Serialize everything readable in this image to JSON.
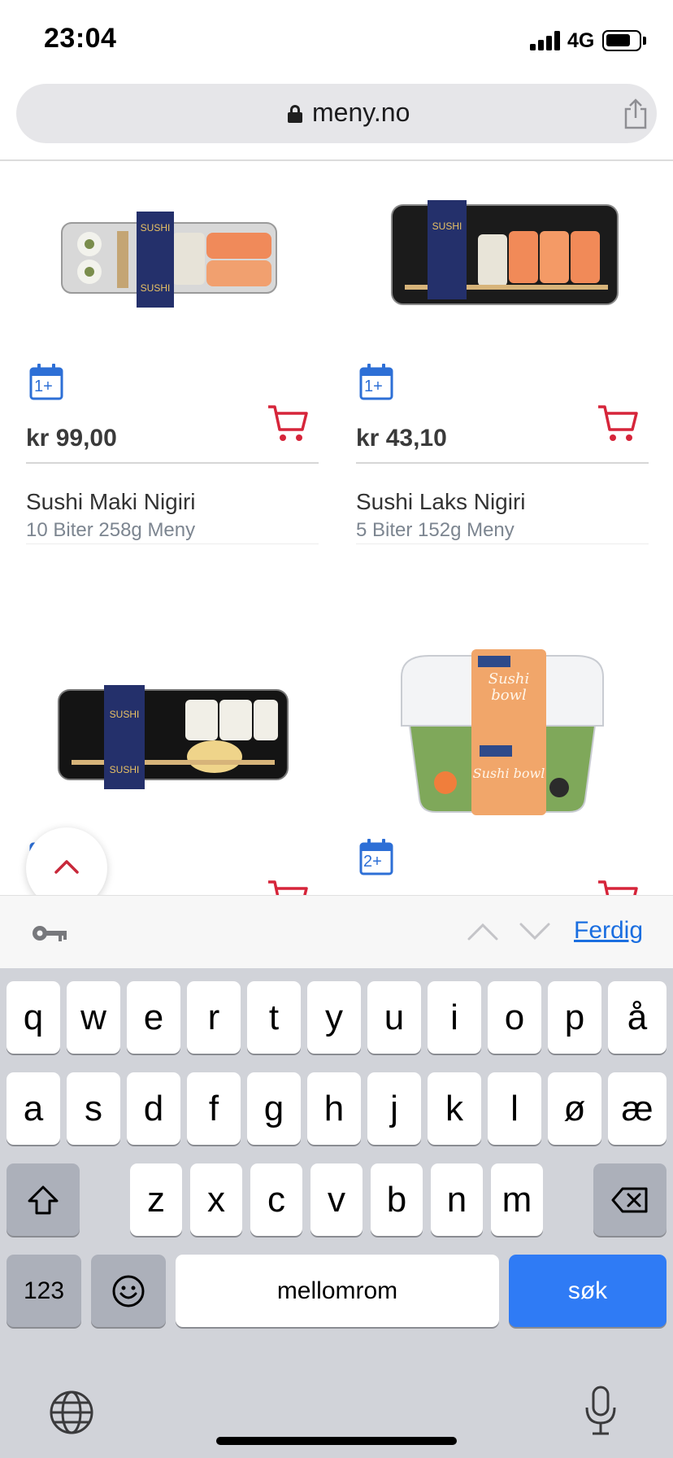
{
  "status_bar": {
    "time": "23:04",
    "network": "4G"
  },
  "browser": {
    "url": "meny.no"
  },
  "products": [
    {
      "name": "Sushi Maki Nigiri",
      "sub": "10 Biter 258g Meny",
      "price": "kr 99,00",
      "badge": "1+"
    },
    {
      "name": "Sushi Laks Nigiri",
      "sub": "5 Biter 152g Meny",
      "price": "kr 43,10",
      "badge": "1+"
    },
    {
      "name": "",
      "sub": "",
      "price": "",
      "badge": ""
    },
    {
      "name": "",
      "sub": "",
      "price": "",
      "badge": "2+"
    }
  ],
  "accessory": {
    "done_label": "Ferdig"
  },
  "keyboard": {
    "row1": [
      "q",
      "w",
      "e",
      "r",
      "t",
      "y",
      "u",
      "i",
      "o",
      "p",
      "å"
    ],
    "row2": [
      "a",
      "s",
      "d",
      "f",
      "g",
      "h",
      "j",
      "k",
      "l",
      "ø",
      "æ"
    ],
    "row3": [
      "z",
      "x",
      "c",
      "v",
      "b",
      "n",
      "m"
    ],
    "numbers_label": "123",
    "space_label": "mellomrom",
    "search_label": "søk"
  },
  "colors": {
    "accent_red": "#d6253a",
    "calendar_blue": "#2d6fd6",
    "link_blue": "#1a6ee0",
    "key_blue": "#2f7bf5"
  },
  "icons": [
    "lock-icon",
    "share-icon",
    "calendar-icon",
    "cart-icon",
    "chevron-up-icon",
    "key-icon",
    "shift-icon",
    "backspace-icon",
    "emoji-icon",
    "globe-icon",
    "microphone-icon"
  ]
}
